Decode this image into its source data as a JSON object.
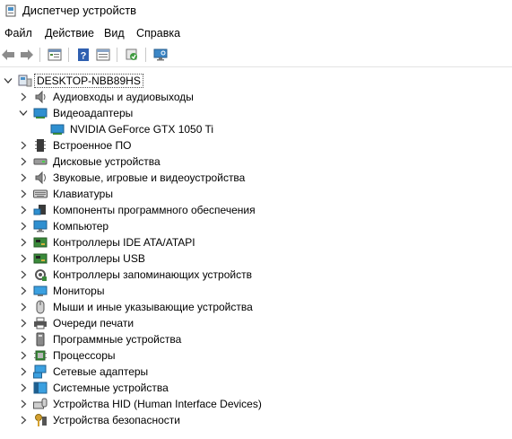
{
  "window": {
    "title": "Диспетчер устройств"
  },
  "menu": [
    "Файл",
    "Действие",
    "Вид",
    "Справка"
  ],
  "toolbar": [
    {
      "icon": "back-arrow-icon",
      "name": "back-button"
    },
    {
      "icon": "forward-arrow-icon",
      "name": "forward-button"
    },
    {
      "icon": "properties-icon",
      "name": "properties-button"
    },
    {
      "icon": "help-icon",
      "name": "help-button"
    },
    {
      "icon": "show-hidden-icon",
      "name": "view-button"
    },
    {
      "icon": "update-driver-icon",
      "name": "update-driver-button"
    },
    {
      "icon": "scan-hardware-icon",
      "name": "scan-hardware-button"
    }
  ],
  "tree": {
    "root": {
      "label": "DESKTOP-NBB89HS",
      "icon": "computer-icon"
    },
    "categories": [
      {
        "label": "Аудиовходы и аудиовыходы",
        "icon": "speaker-icon",
        "expanded": false
      },
      {
        "label": "Видеоадаптеры",
        "icon": "display-adapter-icon",
        "expanded": true,
        "children": [
          {
            "label": "NVIDIA GeForce GTX 1050 Ti",
            "icon": "display-adapter-icon"
          }
        ]
      },
      {
        "label": "Встроенное ПО",
        "icon": "firmware-chip-icon",
        "expanded": false
      },
      {
        "label": "Дисковые устройства",
        "icon": "disk-drive-icon",
        "expanded": false
      },
      {
        "label": "Звуковые, игровые и видеоустройства",
        "icon": "sound-device-icon",
        "expanded": false
      },
      {
        "label": "Клавиатуры",
        "icon": "keyboard-icon",
        "expanded": false
      },
      {
        "label": "Компоненты программного обеспечения",
        "icon": "software-component-icon",
        "expanded": false
      },
      {
        "label": "Компьютер",
        "icon": "computer-monitor-icon",
        "expanded": false
      },
      {
        "label": "Контроллеры IDE ATA/ATAPI",
        "icon": "ide-controller-icon",
        "expanded": false
      },
      {
        "label": "Контроллеры USB",
        "icon": "usb-controller-icon",
        "expanded": false
      },
      {
        "label": "Контроллеры запоминающих устройств",
        "icon": "storage-controller-icon",
        "expanded": false
      },
      {
        "label": "Мониторы",
        "icon": "monitor-icon",
        "expanded": false
      },
      {
        "label": "Мыши и иные указывающие устройства",
        "icon": "mouse-icon",
        "expanded": false
      },
      {
        "label": "Очереди печати",
        "icon": "printer-icon",
        "expanded": false
      },
      {
        "label": "Программные устройства",
        "icon": "software-device-icon",
        "expanded": false
      },
      {
        "label": "Процессоры",
        "icon": "processor-icon",
        "expanded": false
      },
      {
        "label": "Сетевые адаптеры",
        "icon": "network-adapter-icon",
        "expanded": false
      },
      {
        "label": "Системные устройства",
        "icon": "system-device-icon",
        "expanded": false
      },
      {
        "label": "Устройства HID (Human Interface Devices)",
        "icon": "hid-icon",
        "expanded": false
      },
      {
        "label": "Устройства безопасности",
        "icon": "security-device-icon",
        "expanded": false
      }
    ]
  }
}
